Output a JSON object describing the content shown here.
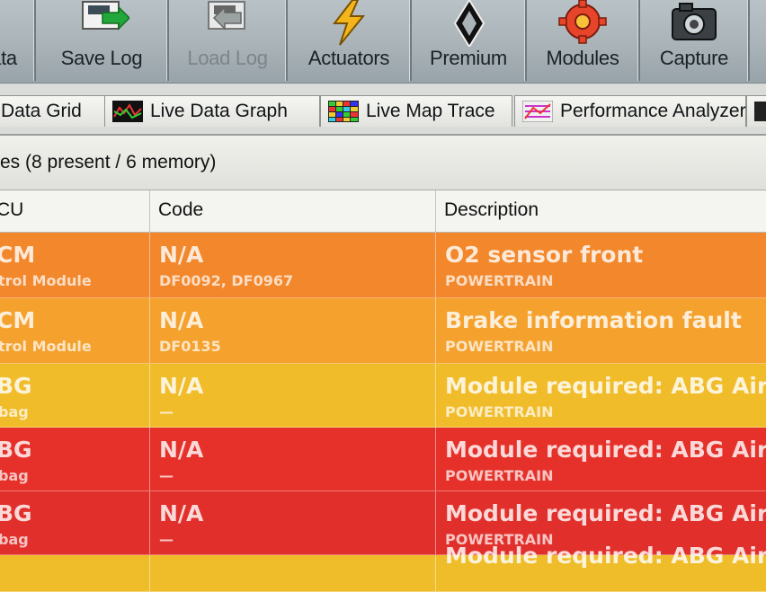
{
  "toolbar": {
    "buttons": [
      {
        "label": "ata",
        "icon": "data-icon"
      },
      {
        "label": "Save Log",
        "icon": "save-log-icon"
      },
      {
        "label": "Load Log",
        "icon": "load-log-icon",
        "disabled": true
      },
      {
        "label": "Actuators",
        "icon": "lightning-icon"
      },
      {
        "label": "Premium",
        "icon": "renault-logo-icon"
      },
      {
        "label": "Modules",
        "icon": "gear-icon"
      },
      {
        "label": "Capture",
        "icon": "camera-icon"
      }
    ]
  },
  "tabs": [
    {
      "label": "Data Grid"
    },
    {
      "label": "Live Data Graph",
      "icon": "graph-icon"
    },
    {
      "label": "Live Map Trace",
      "icon": "map-grid-icon"
    },
    {
      "label": "Performance Analyzer",
      "icon": "performance-icon"
    }
  ],
  "faults_header": "es (8 present / 6 memory)",
  "table": {
    "columns": {
      "ecu": "CU",
      "code": "Code",
      "description": "Description"
    },
    "rows": [
      {
        "ecu": "CM",
        "ecu_sub": "trol Module",
        "code": "N/A",
        "code_sub": "DF0092, DF0967",
        "desc": "O2 sensor front",
        "desc_sub": "POWERTRAIN",
        "color": "#f2872b"
      },
      {
        "ecu": "CM",
        "ecu_sub": "trol Module",
        "code": "N/A",
        "code_sub": "DF0135",
        "desc": "Brake information fault",
        "desc_sub": "POWERTRAIN",
        "color": "#f5a12d"
      },
      {
        "ecu": "BG",
        "ecu_sub": "bag",
        "code": "N/A",
        "code_sub": "—",
        "desc": "Module required: ABG Airb",
        "desc_sub": "POWERTRAIN",
        "color": "#f0bc2a"
      },
      {
        "ecu": "BG",
        "ecu_sub": "bag",
        "code": "N/A",
        "code_sub": "—",
        "desc": "Module required: ABG Airb",
        "desc_sub": "POWERTRAIN",
        "color": "#e5312a"
      },
      {
        "ecu": "BG",
        "ecu_sub": "bag",
        "code": "N/A",
        "code_sub": "—",
        "desc": "Module required: ABG Airb",
        "desc_sub": "POWERTRAIN",
        "color": "#e1302b"
      },
      {
        "ecu": "",
        "ecu_sub": "",
        "code": "",
        "code_sub": "",
        "desc": "Module required: ABG Airb",
        "desc_sub": "",
        "color": "#efbd2a"
      }
    ]
  }
}
